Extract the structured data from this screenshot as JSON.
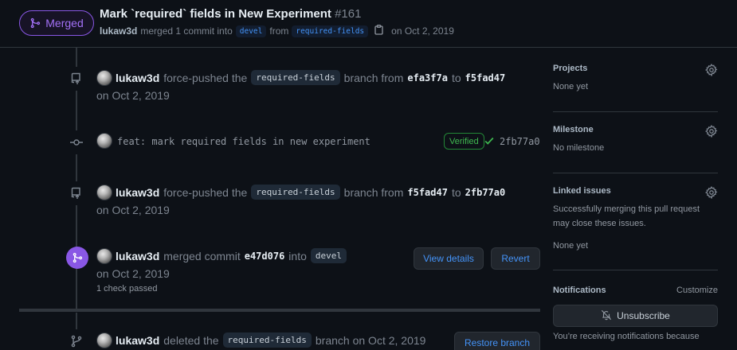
{
  "header": {
    "state_label": "Merged",
    "title": "Mark `required` fields in New Experiment",
    "number": "#161",
    "author": "lukaw3d",
    "merge_text": "merged 1 commit into",
    "base_branch": "devel",
    "from_text": "from",
    "head_branch": "required-fields",
    "date_text": "on Oct 2, 2019"
  },
  "timeline": {
    "event1": {
      "actor": "lukaw3d",
      "action": "force-pushed the",
      "branch": "required-fields",
      "middle": "branch from",
      "from_sha": "efa3f7a",
      "to_text": "to",
      "to_sha": "f5fad47",
      "date": "on Oct 2, 2019"
    },
    "commit": {
      "message": "feat: mark required fields in new experiment",
      "verified": "Verified",
      "sha": "2fb77a0"
    },
    "event2": {
      "actor": "lukaw3d",
      "action": "force-pushed the",
      "branch": "required-fields",
      "middle": "branch from",
      "from_sha": "f5fad47",
      "to_text": "to",
      "to_sha": "2fb77a0",
      "date": "on Oct 2, 2019"
    },
    "merge": {
      "actor": "lukaw3d",
      "action": "merged commit",
      "sha": "e47d076",
      "into_text": "into",
      "branch": "devel",
      "date": "on Oct 2, 2019",
      "checks": "1 check passed",
      "view_details": "View details",
      "revert": "Revert"
    },
    "deleted": {
      "actor": "lukaw3d",
      "action": "deleted the",
      "branch": "required-fields",
      "suffix": "branch on Oct 2, 2019",
      "restore": "Restore branch"
    }
  },
  "sidebar": {
    "projects": {
      "title": "Projects",
      "value": "None yet"
    },
    "milestone": {
      "title": "Milestone",
      "value": "No milestone"
    },
    "linked": {
      "title": "Linked issues",
      "line1": "Successfully merging this pull request",
      "line2": "may close these issues.",
      "value": "None yet"
    },
    "notifications": {
      "title": "Notifications",
      "customize": "Customize",
      "unsubscribe": "Unsubscribe",
      "text": "You’re receiving notifications because"
    }
  },
  "colors": {
    "background": "#0d1117",
    "merged_purple": "#8957e5",
    "link_blue": "#4493f8",
    "verified_green": "#3fb950",
    "border": "#30363d"
  }
}
